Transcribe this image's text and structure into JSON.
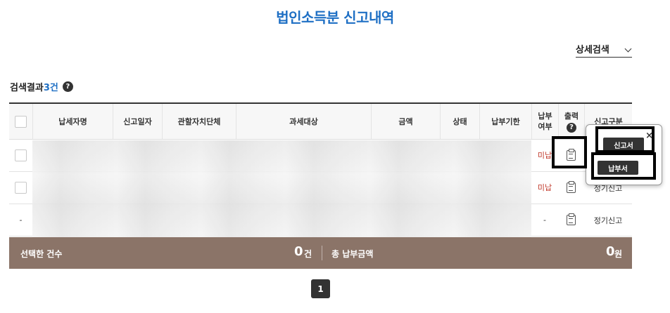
{
  "page": {
    "title": "법인소득분 신고내역"
  },
  "search": {
    "detail_label": "상세검색"
  },
  "result": {
    "prefix": "검색결과 ",
    "count": "3건"
  },
  "table": {
    "headers": {
      "taxpayer": "납세자명",
      "report_date": "신고일자",
      "local_gov": "관할자치단체",
      "tax_target": "과세대상",
      "amount": "금액",
      "status": "상태",
      "due_date": "납부기한",
      "paid_line1": "납부",
      "paid_line2": "여부",
      "print": "출력",
      "report_type": "신고구분"
    },
    "rows": [
      {
        "paid": "미납",
        "report_type": ""
      },
      {
        "paid": "미납",
        "report_type": "정기신고"
      },
      {
        "check": "-",
        "paid": "-",
        "report_type": "정기신고"
      }
    ]
  },
  "summary": {
    "selected_label": "선택한 건수",
    "selected_count": "0",
    "selected_unit": "건",
    "total_label": "총 납부금액",
    "total_amount": "0",
    "total_unit": "원"
  },
  "pagination": {
    "current": "1"
  },
  "popup": {
    "close": "×",
    "report_button": "신고서",
    "payment_button": "납부서"
  },
  "colors": {
    "accent": "#1e6fc4",
    "summary_bg": "#8b7468",
    "unpaid": "#c0392b"
  }
}
